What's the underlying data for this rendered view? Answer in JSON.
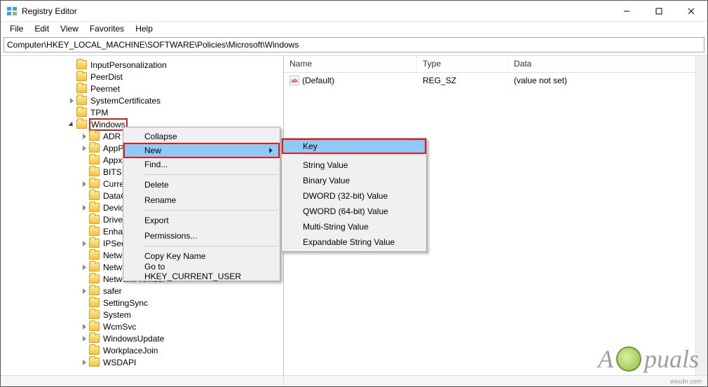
{
  "window": {
    "title": "Registry Editor"
  },
  "menu": {
    "file": "File",
    "edit": "Edit",
    "view": "View",
    "favorites": "Favorites",
    "help": "Help"
  },
  "address": "Computer\\HKEY_LOCAL_MACHINE\\SOFTWARE\\Policies\\Microsoft\\Windows",
  "tree": [
    {
      "label": "InputPersonalization",
      "indent": 112,
      "chev": ""
    },
    {
      "label": "PeerDist",
      "indent": 112,
      "chev": ""
    },
    {
      "label": "Peernet",
      "indent": 112,
      "chev": ""
    },
    {
      "label": "SystemCertificates",
      "indent": 112,
      "chev": "r"
    },
    {
      "label": "TPM",
      "indent": 112,
      "chev": ""
    },
    {
      "label": "Windows",
      "indent": 112,
      "chev": "d",
      "selected": true
    },
    {
      "label": "ADR",
      "indent": 130,
      "chev": "r"
    },
    {
      "label": "AppP",
      "indent": 130,
      "chev": "r"
    },
    {
      "label": "Appx",
      "indent": 130,
      "chev": ""
    },
    {
      "label": "BITS",
      "indent": 130,
      "chev": ""
    },
    {
      "label": "Curre",
      "indent": 130,
      "chev": "r"
    },
    {
      "label": "DataC",
      "indent": 130,
      "chev": ""
    },
    {
      "label": "Devic",
      "indent": 130,
      "chev": "r"
    },
    {
      "label": "Drive",
      "indent": 130,
      "chev": ""
    },
    {
      "label": "Enha",
      "indent": 130,
      "chev": ""
    },
    {
      "label": "IPSec",
      "indent": 130,
      "chev": "r"
    },
    {
      "label": "Netw",
      "indent": 130,
      "chev": ""
    },
    {
      "label": "Netw",
      "indent": 130,
      "chev": "r"
    },
    {
      "label": "NetworkProvider",
      "indent": 130,
      "chev": ""
    },
    {
      "label": "safer",
      "indent": 130,
      "chev": "r"
    },
    {
      "label": "SettingSync",
      "indent": 130,
      "chev": ""
    },
    {
      "label": "System",
      "indent": 130,
      "chev": ""
    },
    {
      "label": "WcmSvc",
      "indent": 130,
      "chev": "r"
    },
    {
      "label": "WindowsUpdate",
      "indent": 130,
      "chev": "r"
    },
    {
      "label": "WorkplaceJoin",
      "indent": 130,
      "chev": ""
    },
    {
      "label": "WSDAPI",
      "indent": 130,
      "chev": "r"
    }
  ],
  "list": {
    "headers": {
      "name": "Name",
      "type": "Type",
      "data": "Data"
    },
    "col_widths": {
      "name": 190,
      "type": 130,
      "data": 260
    },
    "rows": [
      {
        "name": "(Default)",
        "type": "REG_SZ",
        "data": "(value not set)"
      }
    ]
  },
  "context_menu": {
    "collapse": "Collapse",
    "new": "New",
    "find": "Find...",
    "delete": "Delete",
    "rename": "Rename",
    "export": "Export",
    "permissions": "Permissions...",
    "copy_key_name": "Copy Key Name",
    "goto_hkcu": "Go to HKEY_CURRENT_USER"
  },
  "submenu": {
    "key": "Key",
    "string": "String Value",
    "binary": "Binary Value",
    "dword": "DWORD (32-bit) Value",
    "qword": "QWORD (64-bit) Value",
    "multistring": "Multi-String Value",
    "expandable": "Expandable String Value"
  },
  "watermark": {
    "text_a": "A",
    "text_b": "puals"
  },
  "attribution": "wsxdn.com"
}
